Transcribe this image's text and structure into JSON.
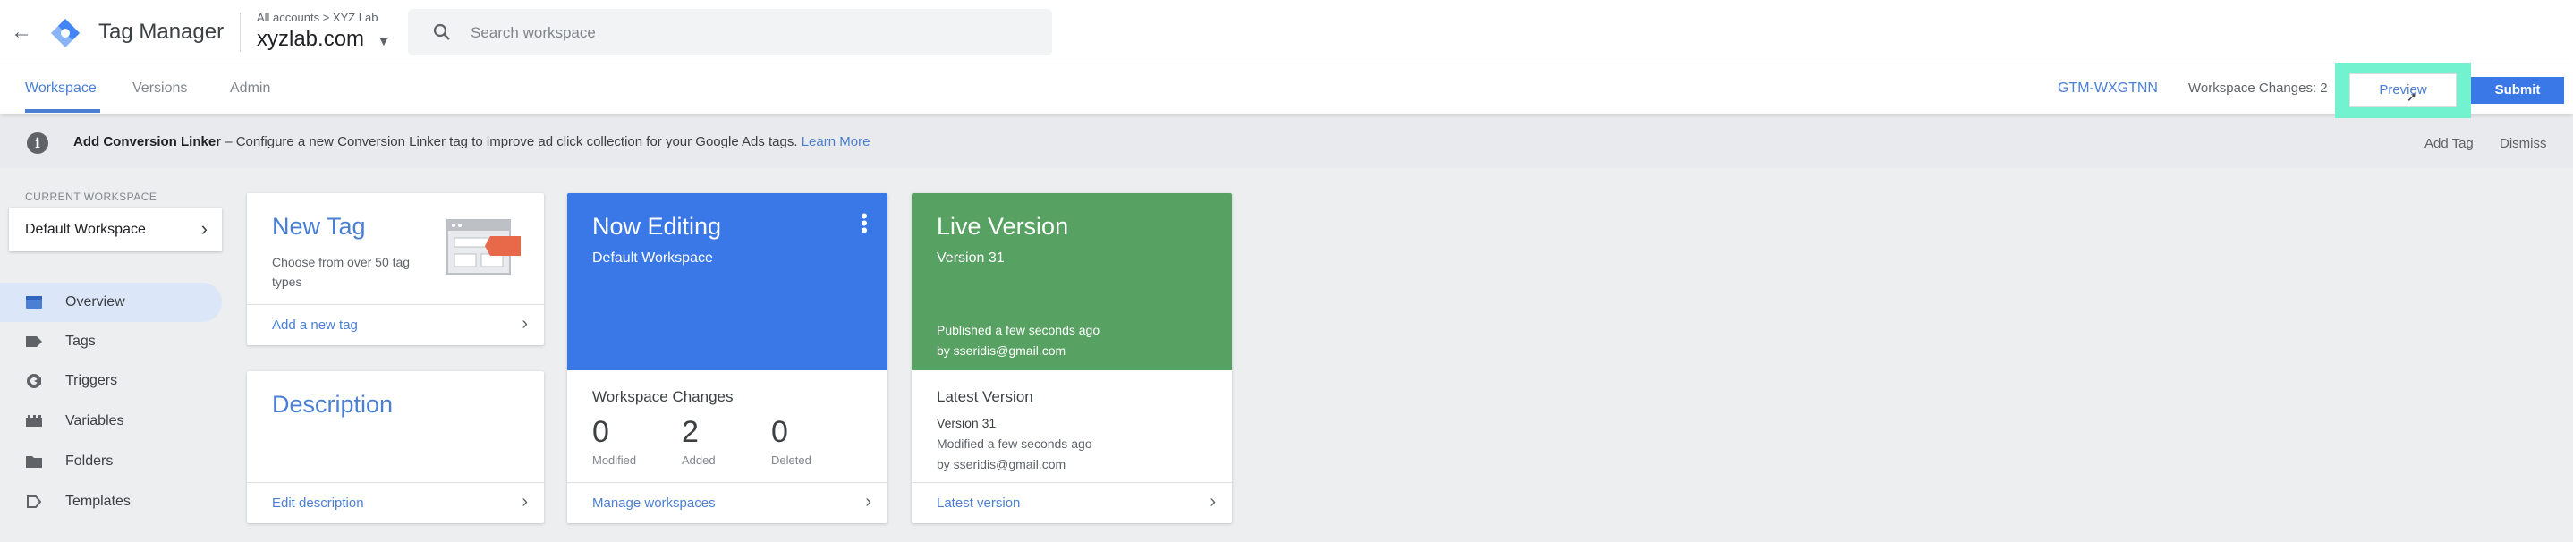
{
  "app": {
    "title": "Tag Manager"
  },
  "account": {
    "breadcrumb": "All accounts > XYZ Lab",
    "container": "xyzlab.com"
  },
  "search": {
    "placeholder": "Search workspace"
  },
  "tabs": [
    {
      "label": "Workspace",
      "active": true
    },
    {
      "label": "Versions",
      "active": false
    },
    {
      "label": "Admin",
      "active": false
    }
  ],
  "header": {
    "container_id": "GTM-WXGTNN",
    "workspace_changes": "Workspace Changes: 2",
    "preview_label": "Preview",
    "submit_label": "Submit"
  },
  "banner": {
    "title": "Add Conversion Linker",
    "message": " – Configure a new Conversion Linker tag to improve ad click collection for your Google Ads tags.",
    "learn_more": "Learn More",
    "add_tag": "Add Tag",
    "dismiss": "Dismiss"
  },
  "sidebar": {
    "current_workspace_label": "CURRENT WORKSPACE",
    "current_workspace": "Default Workspace",
    "items": [
      {
        "label": "Overview",
        "icon": "overview-icon",
        "active": true
      },
      {
        "label": "Tags",
        "icon": "tag-icon",
        "active": false
      },
      {
        "label": "Triggers",
        "icon": "trigger-icon",
        "active": false
      },
      {
        "label": "Variables",
        "icon": "variables-icon",
        "active": false
      },
      {
        "label": "Folders",
        "icon": "folder-icon",
        "active": false
      },
      {
        "label": "Templates",
        "icon": "template-icon",
        "active": false
      }
    ]
  },
  "cards": {
    "new_tag": {
      "title": "New Tag",
      "description": "Choose from over 50 tag types",
      "link": "Add a new tag"
    },
    "description": {
      "title": "Description",
      "link": "Edit description"
    },
    "now_editing": {
      "title": "Now Editing",
      "subtitle": "Default Workspace",
      "changes_label": "Workspace Changes",
      "stats": [
        {
          "value": "0",
          "label": "Modified"
        },
        {
          "value": "2",
          "label": "Added"
        },
        {
          "value": "0",
          "label": "Deleted"
        }
      ],
      "link": "Manage workspaces"
    },
    "live_version": {
      "title": "Live Version",
      "subtitle": "Version 31",
      "published": "Published a few seconds ago",
      "published_by": "by sseridis@gmail.com",
      "latest_label": "Latest Version",
      "latest_version": "Version 31",
      "latest_modified": "Modified a few seconds ago",
      "latest_by": "by sseridis@gmail.com",
      "link": "Latest version"
    }
  },
  "colors": {
    "accent": "#4a7fd4",
    "now_editing": "#3b78e7",
    "live_version": "#57a262",
    "preview_highlight": "#73f2cf",
    "submit": "#3b78e7"
  }
}
